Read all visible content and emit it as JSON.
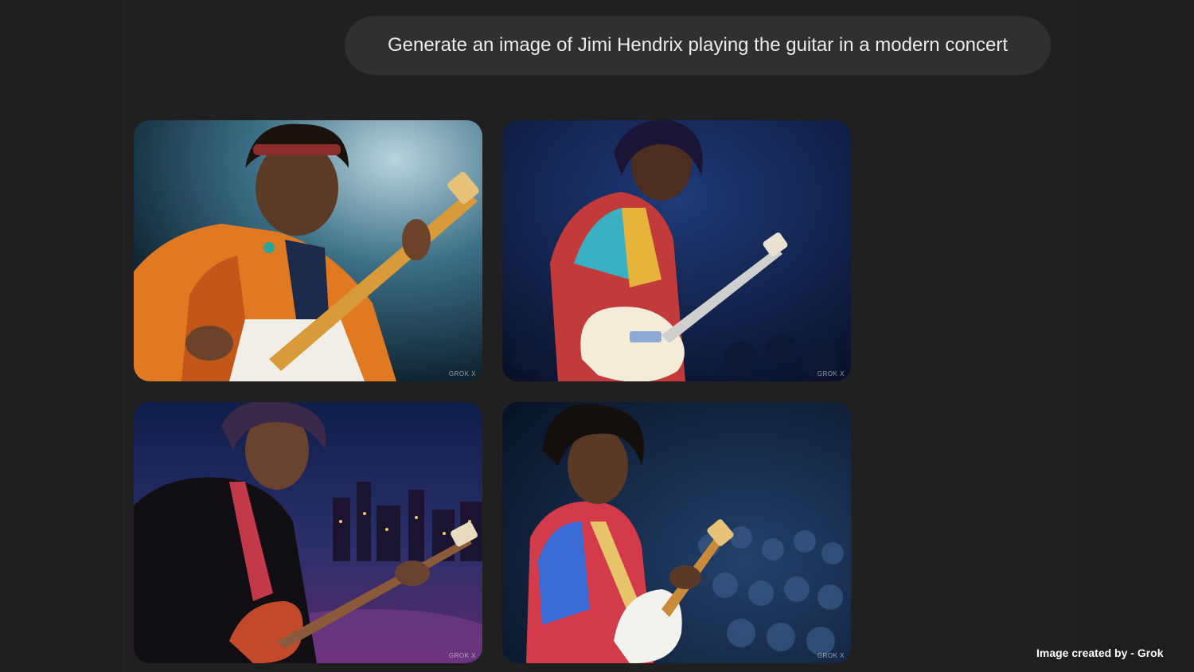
{
  "prompt": {
    "text": "Generate an image of Jimi Hendrix playing the guitar in a modern concert"
  },
  "images": [
    {
      "label": "Jimi Hendrix playing guitar, image 1",
      "watermark": "GROK X"
    },
    {
      "label": "Jimi Hendrix playing guitar, image 2",
      "watermark": "GROK X"
    },
    {
      "label": "Jimi Hendrix playing guitar, image 3",
      "watermark": "GROK X"
    },
    {
      "label": "Jimi Hendrix playing guitar, image 4",
      "watermark": "GROK X"
    }
  ],
  "credit": "Image created by - Grok",
  "colors": {
    "background": "#1e1e1e",
    "bubble": "#303030",
    "bubble_text": "#ececec"
  }
}
